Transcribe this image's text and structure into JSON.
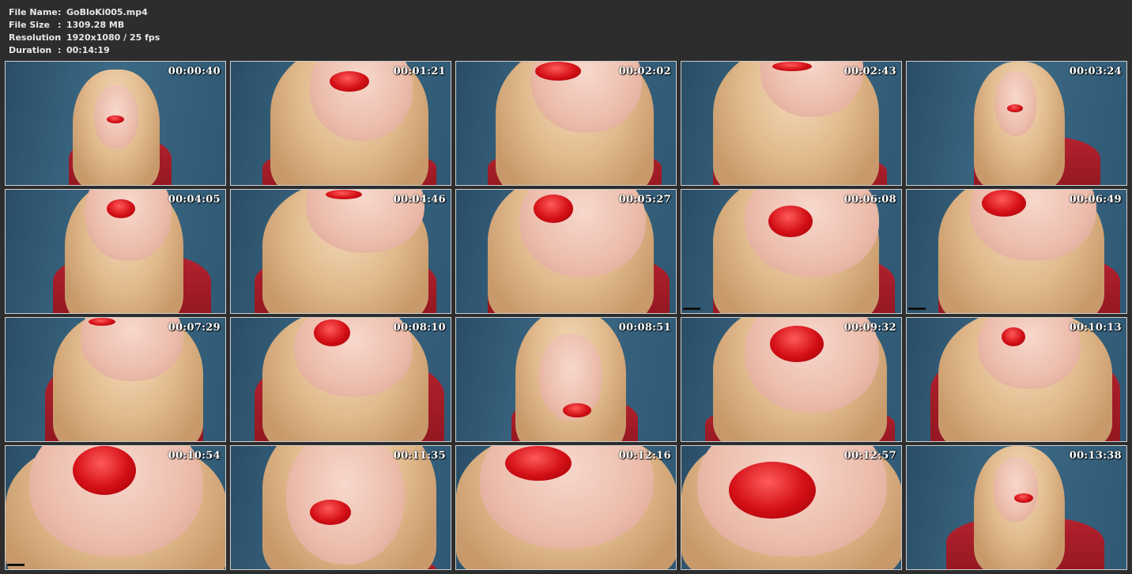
{
  "info": {
    "file_name_label": "File Name",
    "file_name": "GoBloKi005.mp4",
    "file_size_label": "File Size",
    "file_size": "1309.28 MB",
    "resolution_label": "Resolution",
    "resolution": "1920x1080 / 25 fps",
    "duration_label": "Duration",
    "duration": "00:14:19",
    "separator": ":"
  },
  "thumbnails": [
    {
      "time": "00:00:40"
    },
    {
      "time": "00:01:21"
    },
    {
      "time": "00:02:02"
    },
    {
      "time": "00:02:43"
    },
    {
      "time": "00:03:24"
    },
    {
      "time": "00:04:05"
    },
    {
      "time": "00:04:46"
    },
    {
      "time": "00:05:27"
    },
    {
      "time": "00:06:08"
    },
    {
      "time": "00:06:49"
    },
    {
      "time": "00:07:29"
    },
    {
      "time": "00:08:10"
    },
    {
      "time": "00:08:51"
    },
    {
      "time": "00:09:32"
    },
    {
      "time": "00:10:13"
    },
    {
      "time": "00:10:54"
    },
    {
      "time": "00:11:35"
    },
    {
      "time": "00:12:16"
    },
    {
      "time": "00:12:57"
    },
    {
      "time": "00:13:38"
    }
  ]
}
